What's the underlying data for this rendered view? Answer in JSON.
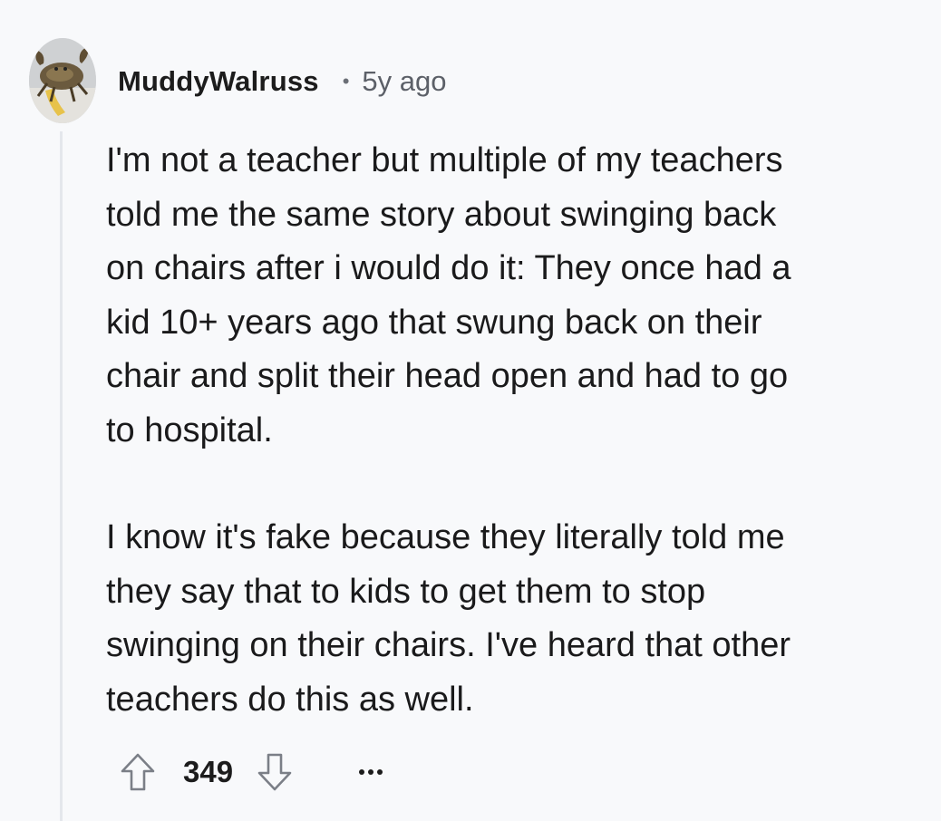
{
  "comment": {
    "author": "MuddyWalruss",
    "separator": "•",
    "timestamp": "5y ago",
    "paragraphs": [
      "I'm not a teacher but multiple of my teachers\ntold me the same story about swinging back\non chairs after i would do it: They once had a\nkid 10+ years ago that swung back on their\nchair and split their head open and had to go\nto hospital.",
      "I know it's fake because they literally told me\nthey say that to kids to get them to stop\nswinging on their chairs. I've heard that other\nteachers do this as well."
    ],
    "score": "349"
  },
  "icons": {
    "avatar": "crab-avatar",
    "upvote": "arrow-up-outline-icon",
    "downvote": "arrow-down-outline-icon",
    "more": "ellipsis-icon"
  },
  "colors": {
    "background": "#f8f9fb",
    "thread_line": "#e4e7ec",
    "text": "#1a1a1b",
    "muted": "#5c6068"
  }
}
